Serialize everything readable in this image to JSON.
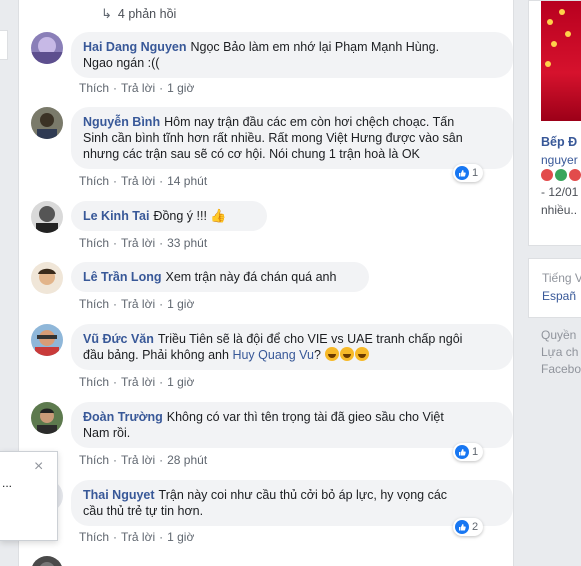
{
  "replies_link": {
    "arrow": "↳",
    "label": "4 phản hồi"
  },
  "comments": [
    {
      "author": "Hai Dang Nguyen",
      "lines": [
        "Ngọc Bảo làm em nhớ lại Phạm Mạnh Hùng.",
        "Ngao ngán :(("
      ],
      "like": "Thích",
      "reply": "Trả lời",
      "time": "1 giờ",
      "reactions": ""
    },
    {
      "author": "Nguyễn Bình",
      "lines": [
        "Hôm nay trận đầu các em còn hơi chệch choạc. Tấn",
        "Sinh cần bình tĩnh hơn rất nhiều. Rất mong Việt Hưng được vào sân",
        "nhưng các trận sau sẽ có cơ hội. Nói chung 1 trận hoà là OK"
      ],
      "like": "Thích",
      "reply": "Trả lời",
      "time": "14 phút",
      "reactions": "1"
    },
    {
      "author": "Le Kinh Tai",
      "lines": [
        "Đồng ý !!!"
      ],
      "like": "Thích",
      "reply": "Trả lời",
      "time": "33 phút",
      "reactions": ""
    },
    {
      "author": "Lê Trần Long",
      "lines": [
        "Xem trận này đá chán quá anh"
      ],
      "like": "Thích",
      "reply": "Trả lời",
      "time": "1 giờ",
      "reactions": ""
    },
    {
      "author": "Vũ Đức Văn",
      "lines": [
        "Triều Tiên sẽ là đội để cho VIE vs UAE tranh chấp ngôi",
        "đầu bảng. Phải không anh"
      ],
      "mention": "Huy Quang Vu",
      "mention_suffix": "?",
      "like": "Thích",
      "reply": "Trả lời",
      "time": "1 giờ",
      "reactions": ""
    },
    {
      "author": "Đoàn Trường",
      "lines": [
        "Không có var thì tên trọng tài đã gieo sầu cho Việt",
        "Nam rồi."
      ],
      "like": "Thích",
      "reply": "Trả lời",
      "time": "28 phút",
      "reactions": "1"
    },
    {
      "author": "Thai Nguyet",
      "lines": [
        "Trận này coi như cầu thủ cởi bỏ áp lực, hy vọng các",
        "cầu thủ trẻ tự tin hơn."
      ],
      "like": "Thích",
      "reply": "Trả lời",
      "time": "1 giờ",
      "reactions": "2"
    }
  ],
  "sidebar": {
    "ad_title": "Bếp Đ",
    "ad_sub": "nguyer",
    "ad_line1": "- 12/01",
    "ad_line2": "nhiều..",
    "lang_current": "Tiếng V",
    "lang_other": "Españ",
    "footer_1": "Quyền",
    "footer_2": "Lựa ch",
    "footer_3": "Facebo"
  },
  "popup": {
    "close": "×",
    "dots": "..."
  },
  "colors": {
    "link": "#385898",
    "bubble": "#f2f3f5",
    "like_blue": "#1877f2",
    "page_bg": "#e9ebee"
  }
}
